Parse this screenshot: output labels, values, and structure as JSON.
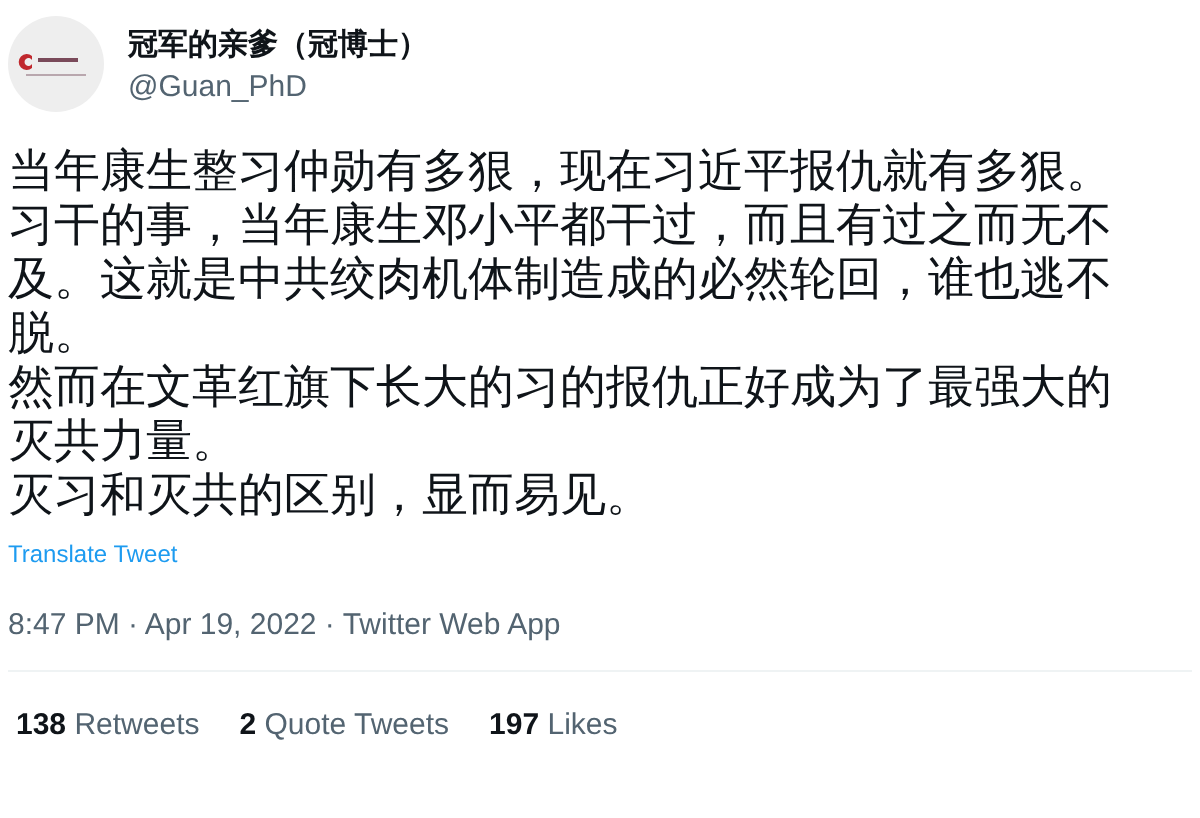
{
  "author": {
    "name": "冠军的亲爹（冠博士）",
    "handle": "@Guan_PhD"
  },
  "paragraphs": [
    "当年康生整习仲勋有多狠，现在习近平报仇就有多狠。",
    "习干的事，当年康生邓小平都干过，而且有过之而无不及。这就是中共绞肉机体制造成的必然轮回，谁也逃不脱。",
    "然而在文革红旗下长大的习的报仇正好成为了最强大的灭共力量。",
    "灭习和灭共的区别，显而易见。"
  ],
  "translate_link": "Translate Tweet",
  "meta": "8:47 PM · Apr 19, 2022 · Twitter Web App",
  "stats": [
    {
      "count": "138",
      "label": "Retweets"
    },
    {
      "count": "2",
      "label": "Quote Tweets"
    },
    {
      "count": "197",
      "label": "Likes"
    }
  ]
}
